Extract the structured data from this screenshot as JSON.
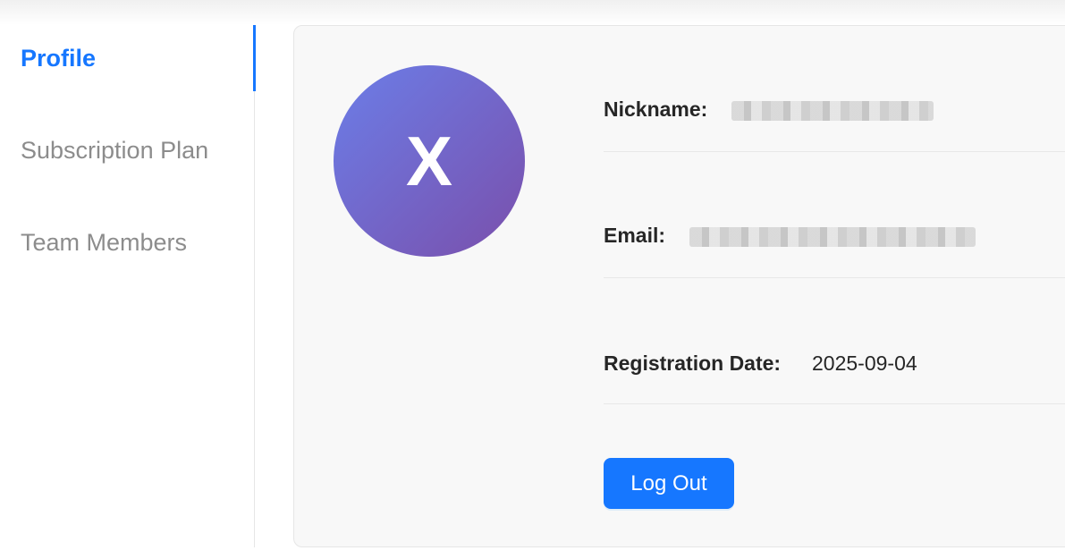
{
  "sidebar": {
    "items": [
      {
        "label": "Profile",
        "active": true
      },
      {
        "label": "Subscription Plan",
        "active": false
      },
      {
        "label": "Team Members",
        "active": false
      }
    ]
  },
  "profile": {
    "avatar_initial": "X",
    "nickname_label": "Nickname:",
    "email_label": "Email:",
    "registration_label": "Registration Date:",
    "registration_date": "2025-09-04",
    "logout_label": "Log Out"
  },
  "colors": {
    "accent": "#1677ff",
    "avatar_gradient_start": "#6b7ee8",
    "avatar_gradient_end": "#7a4fab"
  }
}
